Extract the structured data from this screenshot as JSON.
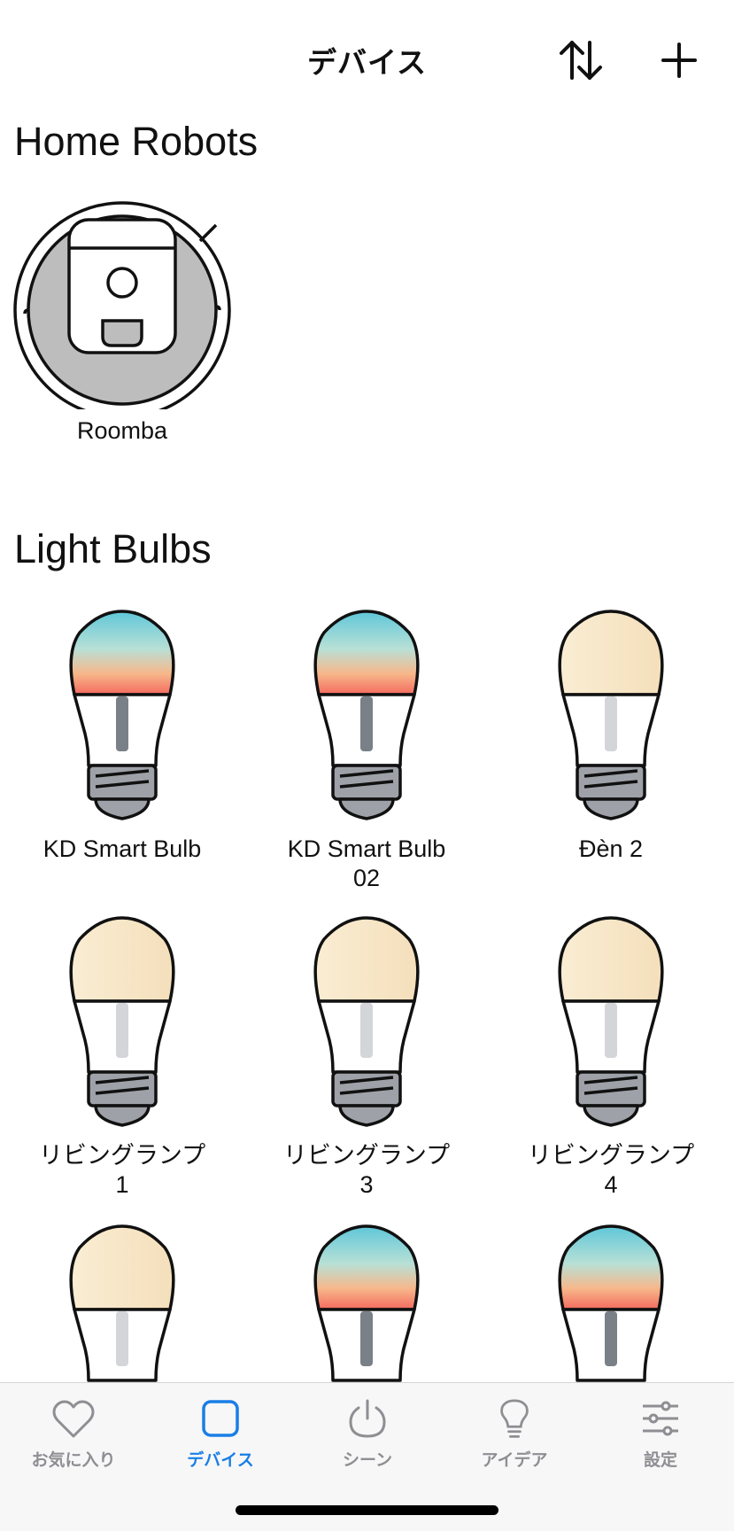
{
  "header": {
    "title": "デバイス",
    "sort_icon": "sort-arrows-icon",
    "add_icon": "plus-icon"
  },
  "sections": {
    "robots": {
      "title": "Home Robots",
      "devices": [
        {
          "name": "Roomba",
          "icon": "robot-vacuum-icon"
        }
      ]
    },
    "bulbs": {
      "title": "Light Bulbs",
      "devices": [
        {
          "name": "KD Smart Bulb",
          "icon": "color-bulb-icon"
        },
        {
          "name": "KD Smart Bulb 02",
          "icon": "color-bulb-icon"
        },
        {
          "name": "Đèn 2",
          "icon": "white-bulb-icon"
        },
        {
          "name": "リビングランプ 1",
          "icon": "white-bulb-icon"
        },
        {
          "name": "リビングランプ 3",
          "icon": "white-bulb-icon"
        },
        {
          "name": "リビングランプ 4",
          "icon": "white-bulb-icon"
        },
        {
          "name": "",
          "icon": "white-bulb-icon"
        },
        {
          "name": "",
          "icon": "color-bulb-icon"
        },
        {
          "name": "",
          "icon": "color-bulb-icon"
        }
      ]
    }
  },
  "tabbar": {
    "tabs": [
      {
        "label": "お気に入り",
        "icon": "heart-icon",
        "active": false
      },
      {
        "label": "デバイス",
        "icon": "rounded-square-icon",
        "active": true
      },
      {
        "label": "シーン",
        "icon": "power-icon",
        "active": false
      },
      {
        "label": "アイデア",
        "icon": "lightbulb-icon",
        "active": false
      },
      {
        "label": "設定",
        "icon": "sliders-icon",
        "active": false
      }
    ]
  },
  "colors": {
    "accent": "#1a7ee6",
    "inactive": "#8e8e93",
    "warm_bulb": "#f8e6c4",
    "bulb_stem_on": "#7a8087",
    "bulb_stem_off": "#d3d5d9"
  }
}
